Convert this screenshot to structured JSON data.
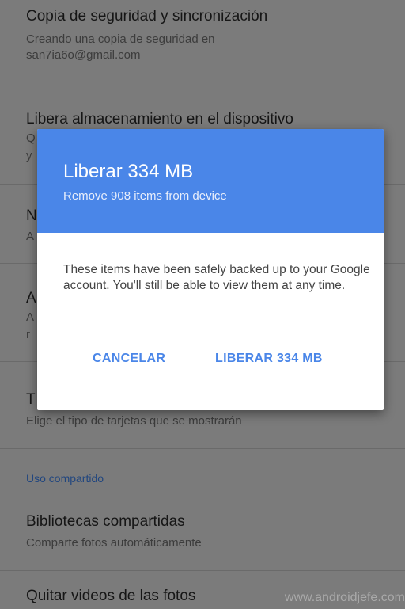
{
  "settings": {
    "backup": {
      "title": "Copia de seguridad y sincronización",
      "subtitle_line1": "Creando una copia de seguridad en",
      "subtitle_line2": "san7ia6o@gmail.com"
    },
    "free_storage": {
      "title": "Libera almacenamiento en el dispositivo"
    },
    "cards": {
      "subtitle": "Elige el tipo de tarjetas que se mostrarán"
    },
    "shared_section_header": "Uso compartido",
    "shared_libraries": {
      "title": "Bibliotecas compartidas",
      "subtitle": "Comparte fotos automáticamente"
    },
    "remove_videos": {
      "title": "Quitar videos de las fotos"
    }
  },
  "obscured_fragments": {
    "q": "Q",
    "y": "y",
    "n": "N",
    "a_sub": "A",
    "a_title": "A",
    "a2_sub": "A",
    "r": "r",
    "t": "T"
  },
  "dialog": {
    "title": "Liberar 334 MB",
    "subtitle": "Remove 908 items from device",
    "body": "These items have been safely backed up to your Google account. You'll still be able to view them at any time.",
    "cancel_label": "CANCELAR",
    "confirm_label": "LIBERAR 334 MB"
  },
  "watermark": "www.androidjefe.com"
}
